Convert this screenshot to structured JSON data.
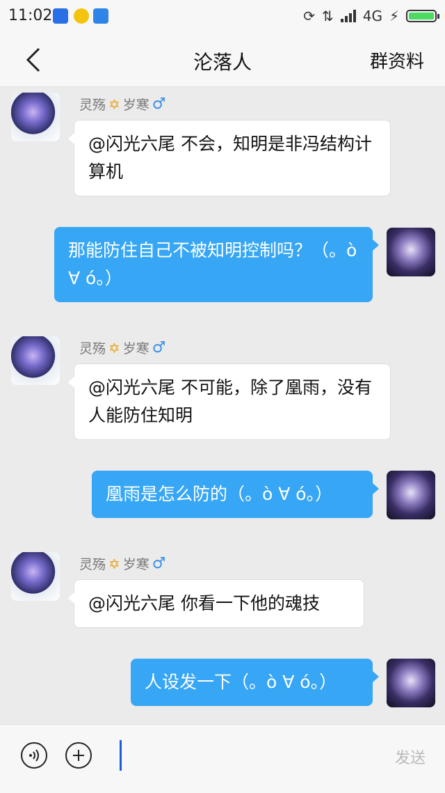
{
  "status_bar": {
    "time": "11:02",
    "network": "4G",
    "icons": [
      "baidu-app-icon",
      "music-app-icon",
      "tieba-app-icon",
      "sync-icon",
      "data-transfer-icon",
      "signal-icon",
      "charging-icon",
      "battery-icon"
    ]
  },
  "header": {
    "title": "沦落人",
    "right_action": "群资料"
  },
  "messages": [
    {
      "direction": "in",
      "sender_name": "灵殇",
      "sender_name_suffix": "岁寒",
      "text": "@闪光六尾 不会，知明是非冯结构计算机"
    },
    {
      "direction": "out",
      "text": "那能防住自己不被知明控制吗？（。ò ∀ ó。）"
    },
    {
      "direction": "in",
      "sender_name": "灵殇",
      "sender_name_suffix": "岁寒",
      "text": "@闪光六尾 不可能，除了凰雨，没有人能防住知明"
    },
    {
      "direction": "out",
      "text": "凰雨是怎么防的（。ò ∀ ó。）"
    },
    {
      "direction": "in",
      "sender_name": "灵殇",
      "sender_name_suffix": "岁寒",
      "text": "@闪光六尾 你看一下他的魂技"
    },
    {
      "direction": "out",
      "text": "人设发一下（。ò ∀ ó。）"
    }
  ],
  "input_bar": {
    "send_label": "发送"
  },
  "colors": {
    "outgoing_bubble": "#36a6f5",
    "incoming_bubble": "#ffffff",
    "background": "#ebebeb"
  }
}
